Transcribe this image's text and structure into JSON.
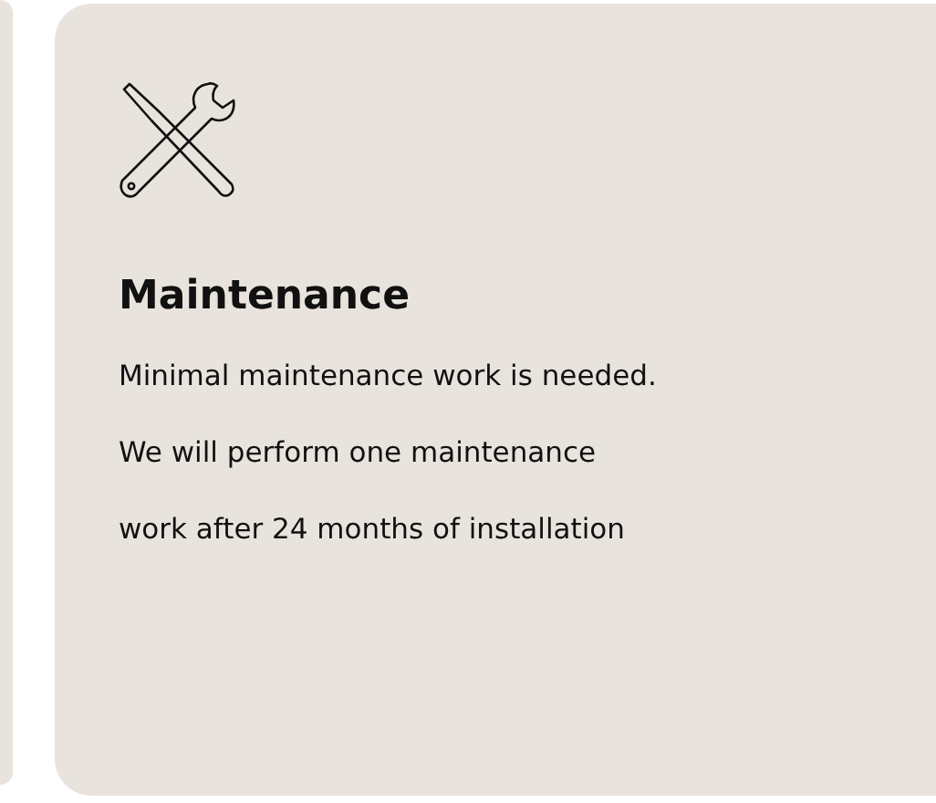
{
  "cards": [
    {
      "title": "Maintenance",
      "description": "Minimal maintenance work is needed. We will perform one maintenance work after 24 months of installation"
    }
  ]
}
